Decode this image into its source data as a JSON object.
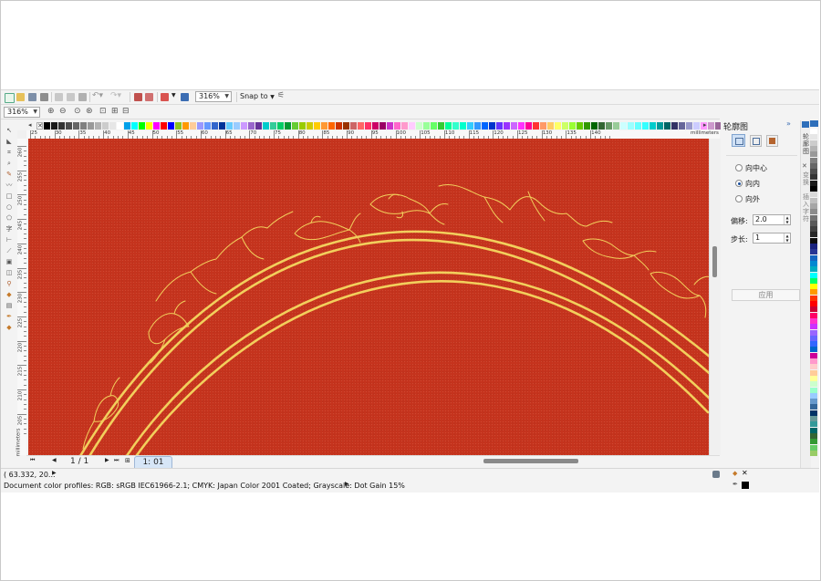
{
  "toolbar": {
    "zoom_value": "316%",
    "snap_label": "Snap to",
    "zoom_value_secondary": "316%"
  },
  "ruler": {
    "unit": "millimeters",
    "x_ticks": [
      "25",
      "30",
      "35",
      "40",
      "45",
      "50",
      "55",
      "60",
      "65",
      "70",
      "75",
      "80",
      "85",
      "90",
      "95",
      "100",
      "105",
      "110",
      "115",
      "120",
      "125",
      "130",
      "135",
      "140"
    ],
    "y_ticks": [
      "260",
      "255",
      "250",
      "245",
      "240",
      "235",
      "230",
      "225",
      "220",
      "215",
      "210",
      "205"
    ]
  },
  "docker": {
    "title": "轮廓图",
    "options": [
      "向中心",
      "向内",
      "向外"
    ],
    "selected_option": "向内",
    "offset_label": "偏移:",
    "offset_value": "2.0",
    "steps_label": "步长:",
    "steps_value": "1",
    "apply_label": "应用"
  },
  "side_tabs": [
    "轮廓图",
    "变换",
    "插入字符"
  ],
  "page_nav": {
    "page_count": "1 / 1",
    "page_tab": "1: 01"
  },
  "status": {
    "coordinates": "( 63.332, 20...",
    "color_profiles": "Document color profiles: RGB: sRGB IEC61966-2.1; CMYK: Japan Color 2001 Coated; Grayscale: Dot Gain 15%"
  },
  "colors": {
    "canvas_red": "#c5331d",
    "gold_line": "#f2cf5c",
    "accent_blue": "#1b4f9c"
  }
}
